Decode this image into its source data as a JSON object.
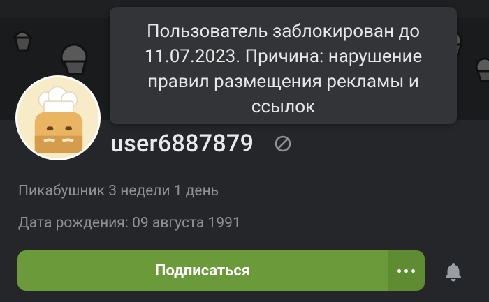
{
  "profile": {
    "username": "user6887879",
    "rank_text": "Пикабушник 3 недели 1 день",
    "birth_text": "Дата рождения: 09 августа 1991"
  },
  "tooltip": {
    "lines": [
      "Пользователь заблокирован до",
      "11.07.2023. Причина: нарушение",
      "правил размещения рекламы и",
      "ссылок"
    ]
  },
  "actions": {
    "subscribe_label": "Подписаться"
  },
  "icons": {
    "ban": "ban-icon",
    "more": "more-dots-icon",
    "bell": "bell-icon",
    "avatar": "chef-avatar"
  },
  "colors": {
    "accent_green": "#6b9a3b",
    "background": "#252629",
    "tooltip_bg": "#333437"
  }
}
